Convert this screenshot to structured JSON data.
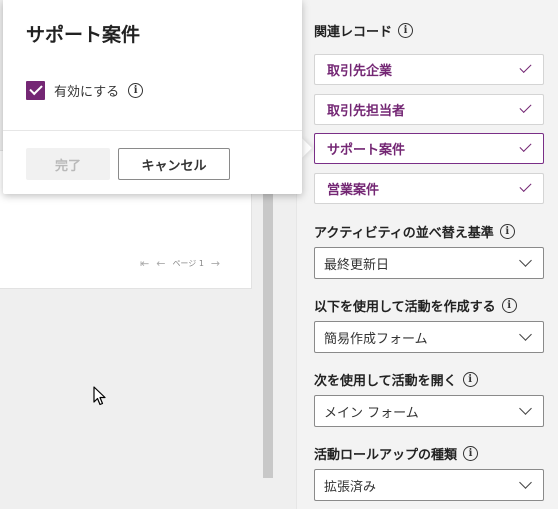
{
  "pager": {
    "first_icon": "⇤",
    "prev_icon": "←",
    "page_text": "ページ 1",
    "next_icon": "→"
  },
  "popup": {
    "title": "サポート案件",
    "enable_label": "有効にする",
    "enable_checked": true,
    "info_icon": "i",
    "done_label": "完了",
    "cancel_label": "キャンセル"
  },
  "panel": {
    "related_records_label": "関連レコード",
    "related_records": [
      {
        "label": "取引先企業",
        "checked": true,
        "selected": false
      },
      {
        "label": "取引先担当者",
        "checked": true,
        "selected": false
      },
      {
        "label": "サポート案件",
        "checked": true,
        "selected": true
      },
      {
        "label": "営業案件",
        "checked": true,
        "selected": false
      }
    ],
    "activity_sort": {
      "label": "アクティビティの並べ替え基準",
      "value": "最終更新日"
    },
    "create_activity": {
      "label": "以下を使用して活動を作成する",
      "value": "簡易作成フォーム"
    },
    "open_activity": {
      "label": "次を使用して活動を開く",
      "value": "メイン フォーム"
    },
    "rollup_type": {
      "label": "活動ロールアップの種類",
      "value": "拡張済み"
    },
    "info_icon": "i"
  },
  "colors": {
    "accent": "#742774",
    "selected_border": "#7a2f87"
  }
}
